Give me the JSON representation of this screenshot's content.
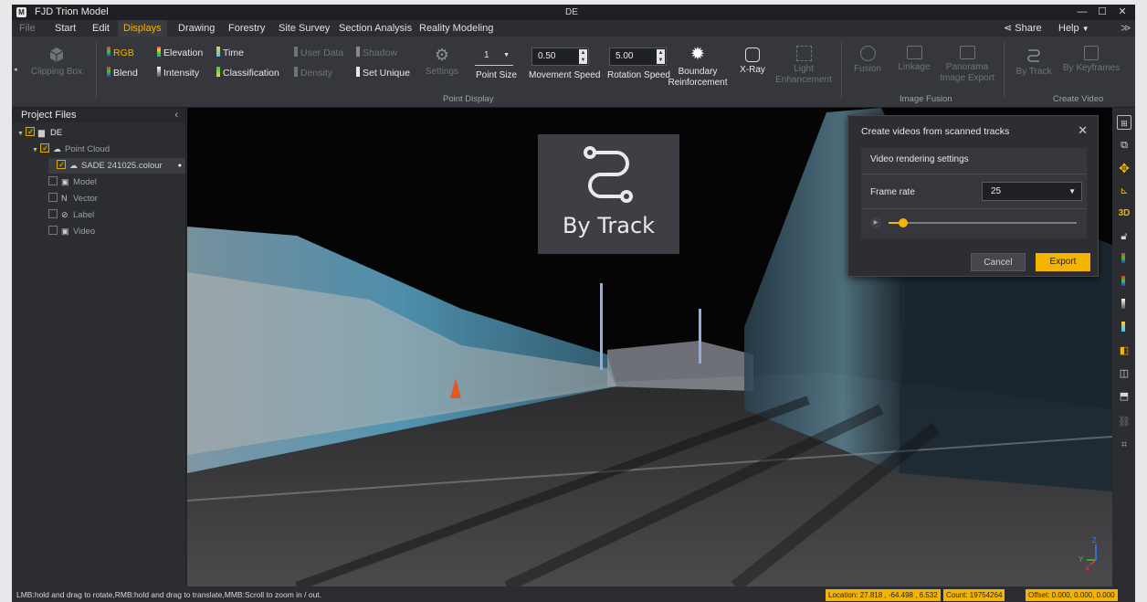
{
  "window": {
    "app_title": "FJD Trion Model",
    "doc_title": "DE",
    "controls": [
      "—",
      "☐",
      "✕"
    ]
  },
  "menu": {
    "items": [
      "File",
      "Start",
      "Edit",
      "Displays",
      "Drawing",
      "Forestry",
      "Site Survey",
      "Section Analysis",
      "Reality Modeling"
    ],
    "active": "Displays",
    "share": "Share",
    "help": "Help"
  },
  "ribbon": {
    "clipping_box": "Clipping Box",
    "color_modes": {
      "rgb": "RGB",
      "elevation": "Elevation",
      "time": "Time",
      "user_data": "User Data",
      "shadow": "Shadow",
      "blend": "Blend",
      "intensity": "Intensity",
      "classification": "Classification",
      "density": "Density",
      "set_unique": "Set Unique"
    },
    "settings": "Settings",
    "point_size": {
      "label": "Point Size",
      "value": "1"
    },
    "movement_speed": {
      "label": "Movement Speed",
      "value": "0.50"
    },
    "rotation_speed": {
      "label": "Rotation Speed",
      "value": "5.00"
    },
    "boundary": "Boundary Reinforcement",
    "xray": "X-Ray",
    "light": "Light Enhancement",
    "point_display_group": "Point Display",
    "fusion": "Fusion",
    "linkage": "Linkage",
    "panorama": "Panorama Image Export",
    "image_fusion_group": "Image Fusion",
    "by_track": "By Track",
    "by_keyframes": "By Keyframes",
    "create_video_group": "Create Video"
  },
  "sidebar": {
    "title": "Project Files",
    "tree": [
      {
        "label": "DE",
        "checked": true
      },
      {
        "label": "Point Cloud",
        "checked": true
      },
      {
        "label": "SADE 241025.colour",
        "checked": true
      },
      {
        "label": "Model",
        "checked": false
      },
      {
        "label": "Vector",
        "checked": false
      },
      {
        "label": "Label",
        "checked": false
      },
      {
        "label": "Video",
        "checked": false
      }
    ]
  },
  "overlay": {
    "label": "By Track"
  },
  "dialog": {
    "title": "Create videos from scanned tracks",
    "section": "Video rendering settings",
    "frame_rate_label": "Frame rate",
    "frame_rate_value": "25",
    "slider_position": 0.08,
    "cancel": "Cancel",
    "export": "Export"
  },
  "right_tools": [
    "grid-icon",
    "camera-icon",
    "orbit-icon",
    "measure-icon",
    "3D",
    "lock-icon",
    "rgb-icon",
    "blend-icon",
    "intensity-icon",
    "time-icon",
    "cube-front-icon",
    "cube-side-icon",
    "cube-top-icon",
    "link-icon",
    "crop-icon"
  ],
  "viewport": {
    "axis_labels": [
      "Z",
      "Y",
      "X"
    ]
  },
  "status": {
    "hint": "LMB:hold and drag to rotate,RMB:hold and drag to translate,MMB:Scroll to zoom in / out.",
    "location": "Location: 27.818 , -64.498 , 6.532",
    "count": "Count: 19754264",
    "offset": "Offset: 0.000, 0.000, 0.000"
  },
  "colors": {
    "accent": "#f4b400",
    "bg": "#2b2d31",
    "ribbon": "#35373c"
  }
}
